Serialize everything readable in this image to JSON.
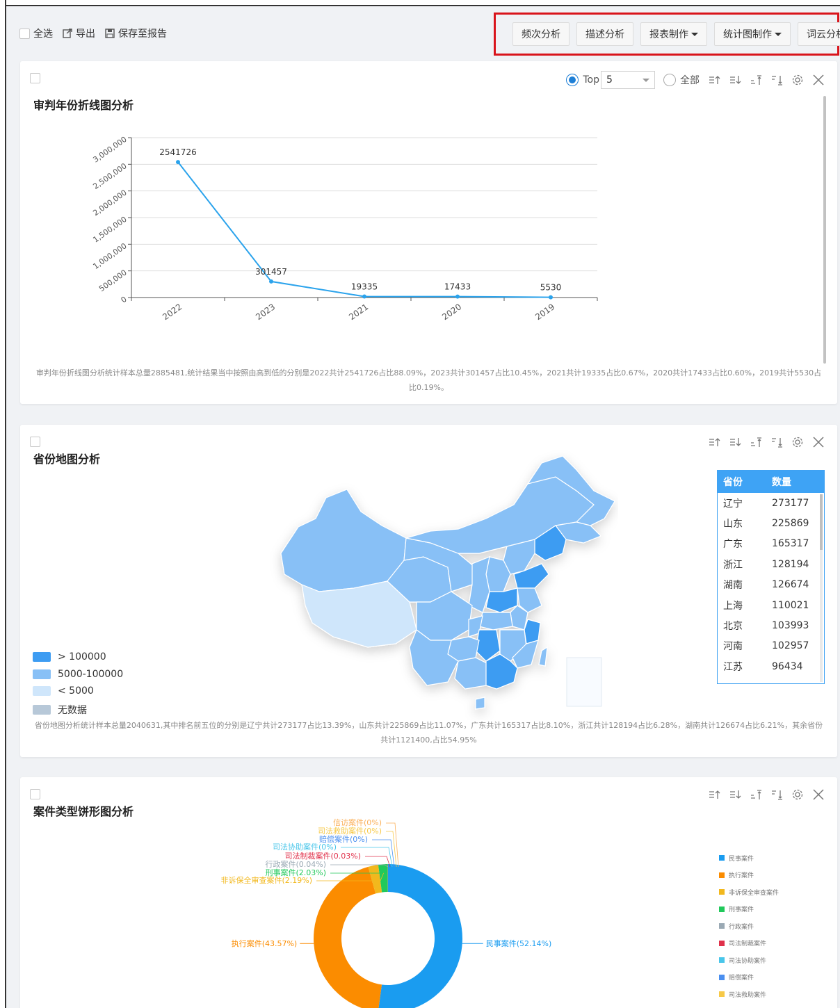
{
  "toolbar": {
    "select_all": "全选",
    "export": "导出",
    "save_report": "保存至报告",
    "buttons": {
      "frequency": "频次分析",
      "describe": "描述分析",
      "report": "报表制作",
      "chart": "统计图制作",
      "wordcloud": "词云分析"
    }
  },
  "panel1": {
    "title": "审判年份折线图分析",
    "top_label": "Top",
    "top_value": "5",
    "all_label": "全部",
    "summary": "审判年份折线图分析统计样本总量2885481,统计结果当中按照由高到低的分别是2022共计2541726占比88.09%，2023共计301457占比10.45%，2021共计19335占比0.67%，2020共计17433占比0.60%，2019共计5530占比0.19%。",
    "chart_data": {
      "type": "line",
      "categories": [
        "2022",
        "2023",
        "2021",
        "2020",
        "2019"
      ],
      "values": [
        2541726,
        301457,
        19335,
        17433,
        5530
      ],
      "ylim": [
        0,
        3000000
      ],
      "yticks": [
        "0",
        "500,000",
        "1,000,000",
        "1,500,000",
        "2,000,000",
        "2,500,000",
        "3,000,000"
      ],
      "data_labels": [
        "2541726",
        "301457",
        "19335",
        "17433",
        "5530"
      ],
      "color": "#2ba3ec"
    }
  },
  "panel2": {
    "title": "省份地图分析",
    "legend": [
      {
        "label": "> 100000",
        "color": "#3d9cf2"
      },
      {
        "label": "5000-100000",
        "color": "#88c0f6"
      },
      {
        "label": "< 5000",
        "color": "#cfe6fb"
      },
      {
        "label": "无数据",
        "color": "#b7c8d8"
      }
    ],
    "table": {
      "headers": [
        "省份",
        "数量"
      ],
      "rows": [
        [
          "辽宁",
          "273177"
        ],
        [
          "山东",
          "225869"
        ],
        [
          "广东",
          "165317"
        ],
        [
          "浙江",
          "128194"
        ],
        [
          "湖南",
          "126674"
        ],
        [
          "上海",
          "110021"
        ],
        [
          "北京",
          "103993"
        ],
        [
          "河南",
          "102957"
        ],
        [
          "江苏",
          "96434"
        ]
      ]
    },
    "summary": "省份地图分析统计样本总量2040631,其中排名前五位的分别是辽宁共计273177占比13.39%，山东共计225869占比11.07%，广东共计165317占比8.10%，浙江共计128194占比6.28%，湖南共计126674占比6.21%，其余省份共计1121400,占比54.95%"
  },
  "panel3": {
    "title": "案件类型饼形图分析",
    "chart_data": {
      "type": "pie",
      "slices": [
        {
          "label": "民事案件(52.14%)",
          "value": 52.14,
          "color": "#1a9cf0"
        },
        {
          "label": "执行案件(43.57%)",
          "value": 43.57,
          "color": "#fb8c00"
        },
        {
          "label": "非诉保全审查案件(2.19%)",
          "value": 2.19,
          "color": "#f2b81d"
        },
        {
          "label": "刑事案件(2.03%)",
          "value": 2.03,
          "color": "#21c95b"
        },
        {
          "label": "行政案件(0.04%)",
          "value": 0.04,
          "color": "#9aa9b4"
        },
        {
          "label": "司法制裁案件(0.03%)",
          "value": 0.03,
          "color": "#e0314b"
        },
        {
          "label": "司法协助案件(0%)",
          "value": 0,
          "color": "#49c6ea"
        },
        {
          "label": "赔偿案件(0%)",
          "value": 0,
          "color": "#4a8ff0"
        },
        {
          "label": "司法救助案件(0%)",
          "value": 0,
          "color": "#f7c948"
        },
        {
          "label": "信访案件(0%)",
          "value": 0,
          "color": "#fbb05a"
        }
      ],
      "legend": [
        "民事案件",
        "执行案件",
        "非诉保全审查案件",
        "刑事案件",
        "行政案件",
        "司法制裁案件",
        "司法协助案件",
        "赔偿案件",
        "司法救助案件"
      ]
    }
  }
}
